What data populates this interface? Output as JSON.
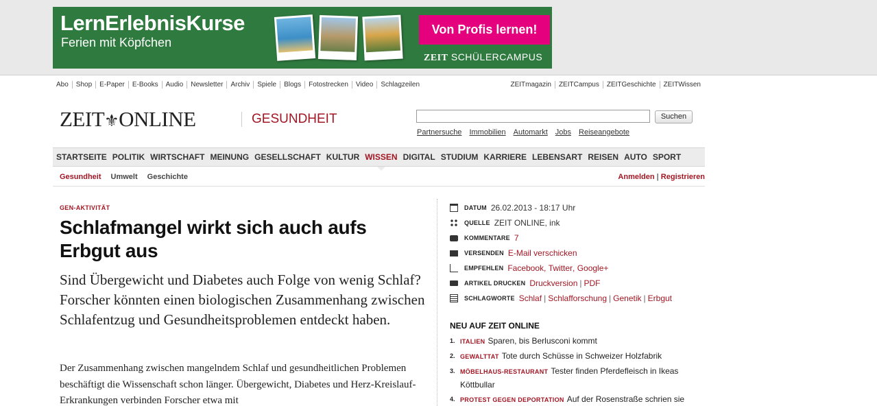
{
  "ad": {
    "title": "LernErlebnisKurse",
    "subtitle": "Ferien mit Köpfchen",
    "cta": "Von Profis lernen!",
    "brand": "ZEIT",
    "brand_suffix": "SCHÜLERCAMPUS"
  },
  "services": {
    "left": [
      "Abo",
      "Shop",
      "E-Paper",
      "E-Books",
      "Audio",
      "Newsletter",
      "Archiv",
      "Spiele",
      "Blogs",
      "Fotostrecken",
      "Video",
      "Schlagzeilen"
    ],
    "right": [
      "ZEITmagazin",
      "ZEITCampus",
      "ZEITGeschichte",
      "ZEITWissen"
    ]
  },
  "header": {
    "logo_left": "ZEIT",
    "logo_right": "ONLINE",
    "section": "GESUNDHEIT",
    "search_button": "Suchen",
    "search_value": "",
    "links": [
      "Partnersuche",
      "Immobilien",
      "Automarkt",
      "Jobs",
      "Reiseangebote"
    ]
  },
  "mainnav": [
    "STARTSEITE",
    "POLITIK",
    "WIRTSCHAFT",
    "MEINUNG",
    "GESELLSCHAFT",
    "KULTUR",
    "WISSEN",
    "DIGITAL",
    "STUDIUM",
    "KARRIERE",
    "LEBENSART",
    "REISEN",
    "AUTO",
    "SPORT"
  ],
  "mainnav_active": "WISSEN",
  "subnav": {
    "items": [
      "Gesundheit",
      "Umwelt",
      "Geschichte"
    ],
    "login": "Anmelden",
    "separator": "|",
    "register": "Registrieren"
  },
  "article": {
    "kicker": "GEN-AKTIVITÄT",
    "headline": "Schlafmangel wirkt sich auch aufs Erbgut aus",
    "intro": "Sind Übergewicht und Diabetes auch Folge von wenig Schlaf? Forscher könnten einen biologischen Zusammenhang zwischen Schlafentzug und Gesundheitsproblemen entdeckt haben.",
    "body": "Der Zusammenhang zwischen mangelndem Schlaf und gesundheitlichen Problemen beschäftigt die Wissenschaft schon länger. Übergewicht, Diabetes und Herz-Kreislauf-Erkrankungen verbinden Forscher etwa mit"
  },
  "meta": {
    "datum_label": "DATUM",
    "datum": "26.02.2013 - 18:17 Uhr",
    "quelle_label": "QUELLE",
    "quelle": "ZEIT ONLINE, ink",
    "kommentare_label": "KOMMENTARE",
    "kommentare": "7",
    "versenden_label": "VERSENDEN",
    "versenden": "E-Mail verschicken",
    "empfehlen_label": "EMPFEHLEN",
    "empfehlen": [
      "Facebook",
      "Twitter",
      "Google+"
    ],
    "drucken_label": "ARTIKEL DRUCKEN",
    "drucken": [
      "Druckversion",
      "PDF"
    ],
    "schlagworte_label": "SCHLAGWORTE",
    "schlagworte": [
      "Schlaf",
      "Schlafforschung",
      "Genetik",
      "Erbgut"
    ]
  },
  "news": {
    "title": "NEU AUF ZEIT ONLINE",
    "items": [
      {
        "num": "1.",
        "cat": "ITALIEN",
        "text": "Sparen, bis Berlusconi kommt"
      },
      {
        "num": "2.",
        "cat": "GEWALTTAT",
        "text": "Tote durch Schüsse in Schweizer Holzfabrik"
      },
      {
        "num": "3.",
        "cat": "MÖBELHAUS-RESTAURANT",
        "text": "Tester finden Pferdefleisch in Ikeas Köttbullar"
      },
      {
        "num": "4.",
        "cat": "PROTEST GEGEN DEPORTATION",
        "text": "Auf der Rosenstraße schrien sie"
      }
    ]
  },
  "colors": {
    "accent": "#a21623",
    "ad_green": "#2f7a3f",
    "ad_pink": "#e5007e",
    "nav_bg": "#ececec"
  }
}
